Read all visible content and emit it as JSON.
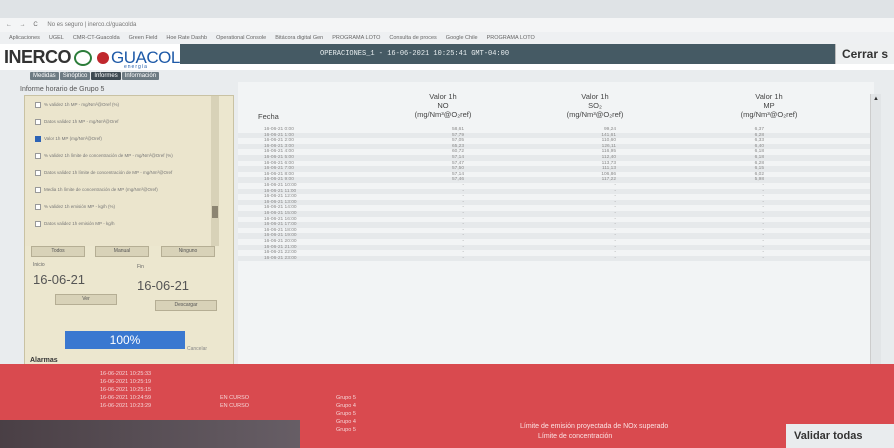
{
  "browser": {
    "url": "No es seguro | inerco.cl/guacolda",
    "bookmarks": [
      "Aplicaciones",
      "UGEL",
      "CMR-CT-Guacolda",
      "Green Field",
      "Hoe Rate Dashb",
      "Operational Console",
      "Bitácora digital Gen",
      "PROGRAMA LOTO",
      "Consulta de proces",
      "Google Chile",
      "PROGRAMA LOTO"
    ]
  },
  "header": {
    "logo_left": "INERCO",
    "logo_right": "GUACOLDA",
    "logo_sub": "energía",
    "status_line": "OPERACIONES_1 - 16-06-2021 10:25:41 GMT-04:00",
    "close_label": "Cerrar s"
  },
  "menu": [
    "Medidas",
    "Sinóptico",
    "Informes",
    "Información"
  ],
  "breadcrumb": "Informe horario de Grupo 5",
  "left_panel": {
    "checklist": [
      {
        "label": "% validez 1h MP - mg/Nm³@Oref (%)",
        "checked": false
      },
      {
        "label": "Datos validez 1h MP - mg/Nm³@Oref",
        "checked": false
      },
      {
        "label": "Valor 1h MP (mg/Nm³@Oref)",
        "checked": true
      },
      {
        "label": "% validez 1h límite de concentración de MP - mg/Nm³@Oref (%)",
        "checked": false
      },
      {
        "label": "Datos validez 1h límite de concentración de MP - mg/Nm³@Oref",
        "checked": false
      },
      {
        "label": "Media 1h límite de concentración de MP (mg/Nm³@Oref)",
        "checked": false
      },
      {
        "label": "% validez 1h emisión MP - kg/h (%)",
        "checked": false
      },
      {
        "label": "Datos validez 1h emisión MP - kg/h",
        "checked": false
      }
    ],
    "buttons": {
      "all": "Todos",
      "manual": "Manual",
      "none": "Ninguno"
    },
    "start_label": "Inicio",
    "end_label": "Fin",
    "start_date": "16-06-21",
    "end_date": "16-06-21",
    "view_button": "Ver",
    "download_button": "Descargar",
    "progress_text": "100%",
    "progress_value": 1.0,
    "cancel_label": "Cancelar"
  },
  "table": {
    "headers": [
      {
        "l1": "Fecha",
        "l2": "",
        "l3": ""
      },
      {
        "l1": "Valor 1h",
        "l2": "NO",
        "l3": "(mg/Nm³@O₂ref)"
      },
      {
        "l1": "Valor 1h",
        "l2": "SO₂",
        "l3": "(mg/Nm³@O₂ref)"
      },
      {
        "l1": "Valor 1h",
        "l2": "MP",
        "l3": "(mg/Nm³@O₂ref)"
      }
    ],
    "rows": [
      [
        "16-06-21 0:00",
        "58,61",
        "99,24",
        "6,37"
      ],
      [
        "16-06-21 1:00",
        "57,79",
        "141,61",
        "6,28"
      ],
      [
        "16-06-21 2:00",
        "57,05",
        "110,60",
        "6,33"
      ],
      [
        "16-06-21 3:00",
        "65,23",
        "126,11",
        "6,40"
      ],
      [
        "16-06-21 4:00",
        "60,72",
        "116,95",
        "6,18"
      ],
      [
        "16-06-21 5:00",
        "57,14",
        "112,40",
        "6,18"
      ],
      [
        "16-06-21 6:00",
        "57,47",
        "113,73",
        "6,28"
      ],
      [
        "16-06-21 7:00",
        "57,50",
        "111,13",
        "6,15"
      ],
      [
        "16-06-21 8:00",
        "57,14",
        "106,86",
        "6,02"
      ],
      [
        "16-06-21 9:00",
        "57,46",
        "117,22",
        "5,98"
      ],
      [
        "16-06-21 10:00",
        "-",
        "-",
        "-"
      ],
      [
        "16-06-21 11:00",
        "-",
        "-",
        "-"
      ],
      [
        "16-06-21 12:00",
        "-",
        "-",
        "-"
      ],
      [
        "16-06-21 13:00",
        "-",
        "-",
        "-"
      ],
      [
        "16-06-21 14:00",
        "-",
        "-",
        "-"
      ],
      [
        "16-06-21 15:00",
        "-",
        "-",
        "-"
      ],
      [
        "16-06-21 16:00",
        "-",
        "-",
        "-"
      ],
      [
        "16-06-21 17:00",
        "-",
        "-",
        "-"
      ],
      [
        "16-06-21 18:00",
        "-",
        "-",
        "-"
      ],
      [
        "16-06-21 19:00",
        "-",
        "-",
        "-"
      ],
      [
        "16-06-21 20:00",
        "-",
        "-",
        "-"
      ],
      [
        "16-06-21 21:00",
        "-",
        "-",
        "-"
      ],
      [
        "16-06-21 22:00",
        "-",
        "-",
        "-"
      ],
      [
        "16-06-21 23:00",
        "-",
        "-",
        "-"
      ]
    ]
  },
  "alarms": {
    "title": "Alarmas",
    "times": [
      "16-06-2021 10:25:33",
      "16-06-2021 10:25:19",
      "16-06-2021 10:25:15",
      "16-06-2021 10:24:59",
      "16-06-2021 10:23:29"
    ],
    "states": [
      "EN CURSO",
      "EN CURSO"
    ],
    "groups": [
      "Grupo 5",
      "Grupo 4",
      "Grupo 5",
      "Grupo 4",
      "Grupo 5"
    ],
    "messages": [
      "Límite de emisión proyectada de NOx superado",
      "Límite de concentración"
    ],
    "validate_label": "Validar todas"
  },
  "colors": {
    "alarm_bg": "#d94a4f",
    "title_bg": "#455a64",
    "progress": "#3a78d0"
  }
}
